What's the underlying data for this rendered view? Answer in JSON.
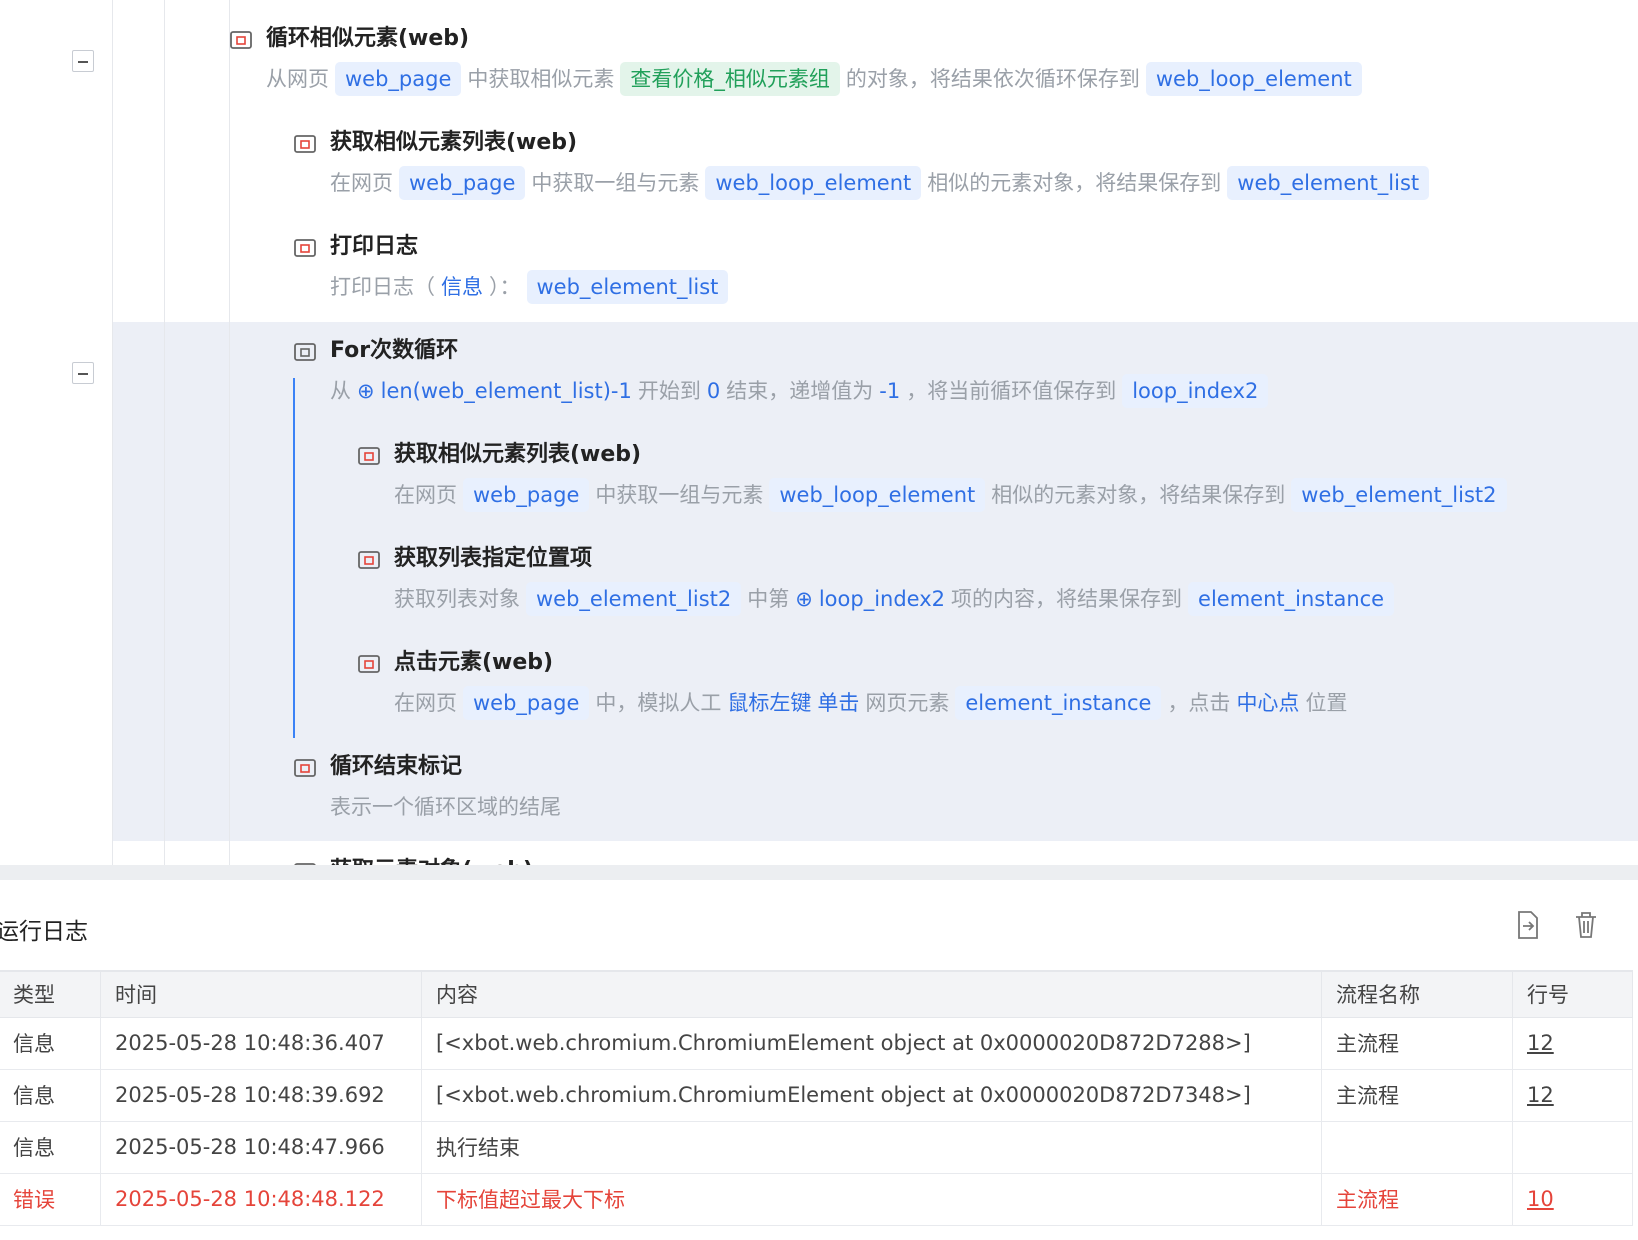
{
  "steps": [
    {
      "title": "循环相似元素(web)",
      "icon": "loop-similar-icon",
      "desc": [
        {
          "t": "从网页",
          "k": "plain"
        },
        {
          "t": "web_page",
          "k": "var"
        },
        {
          "t": "中获取相似元素",
          "k": "plain"
        },
        {
          "t": "查看价格_相似元素组",
          "k": "grn"
        },
        {
          "t": "的对象，将结果依次循环保存到",
          "k": "plain"
        },
        {
          "t": "web_loop_element",
          "k": "var"
        }
      ]
    },
    {
      "title": "获取相似元素列表(web)",
      "icon": "similar-list-icon",
      "desc": [
        {
          "t": "在网页",
          "k": "plain"
        },
        {
          "t": "web_page",
          "k": "var"
        },
        {
          "t": "中获取一组与元素",
          "k": "plain"
        },
        {
          "t": "web_loop_element",
          "k": "var"
        },
        {
          "t": "相似的元素对象，将结果保存到",
          "k": "plain"
        },
        {
          "t": "web_element_list",
          "k": "var"
        }
      ]
    },
    {
      "title": "打印日志",
      "icon": "print-icon",
      "desc": [
        {
          "t": "打印日志（",
          "k": "plain"
        },
        {
          "t": "信息",
          "k": "kw"
        },
        {
          "t": "）：",
          "k": "plain"
        },
        {
          "t": "web_element_list",
          "k": "var"
        }
      ]
    },
    {
      "title": "For次数循环",
      "icon": "for-loop-icon",
      "desc": [
        {
          "t": "从",
          "k": "plain"
        },
        {
          "t": "⊕",
          "k": "kw"
        },
        {
          "t": "len(web_element_list)-1",
          "k": "kw"
        },
        {
          "t": "开始到",
          "k": "plain"
        },
        {
          "t": "0",
          "k": "kw"
        },
        {
          "t": "结束，递增值为",
          "k": "plain"
        },
        {
          "t": "-1",
          "k": "kw"
        },
        {
          "t": "，将当前循环值保存到",
          "k": "plain"
        },
        {
          "t": "loop_index2",
          "k": "var"
        }
      ]
    },
    {
      "title": "获取相似元素列表(web)",
      "icon": "similar-list-icon",
      "desc": [
        {
          "t": "在网页",
          "k": "plain"
        },
        {
          "t": "web_page",
          "k": "var"
        },
        {
          "t": "中获取一组与元素",
          "k": "plain"
        },
        {
          "t": "web_loop_element",
          "k": "var"
        },
        {
          "t": "相似的元素对象，将结果保存到",
          "k": "plain"
        },
        {
          "t": "web_element_list2",
          "k": "var"
        }
      ]
    },
    {
      "title": "获取列表指定位置项",
      "icon": "list-item-icon",
      "desc": [
        {
          "t": "获取列表对象",
          "k": "plain"
        },
        {
          "t": "web_element_list2",
          "k": "var"
        },
        {
          "t": "中第",
          "k": "plain"
        },
        {
          "t": "⊕",
          "k": "kw"
        },
        {
          "t": "loop_index2",
          "k": "kw"
        },
        {
          "t": "项的内容，将结果保存到",
          "k": "plain"
        },
        {
          "t": "element_instance",
          "k": "var"
        }
      ]
    },
    {
      "title": "点击元素(web)",
      "icon": "click-element-icon",
      "desc": [
        {
          "t": "在网页",
          "k": "plain"
        },
        {
          "t": "web_page",
          "k": "var"
        },
        {
          "t": "中，模拟人工",
          "k": "plain"
        },
        {
          "t": "鼠标左键",
          "k": "kw"
        },
        {
          "t": "单击",
          "k": "kw"
        },
        {
          "t": "网页元素",
          "k": "plain"
        },
        {
          "t": "element_instance",
          "k": "var"
        },
        {
          "t": "，点击",
          "k": "plain"
        },
        {
          "t": "中心点",
          "k": "kw"
        },
        {
          "t": "位置",
          "k": "plain"
        }
      ]
    },
    {
      "title": "循环结束标记",
      "icon": "loop-end-icon",
      "desc": [
        {
          "t": "表示一个循环区域的结尾",
          "k": "plain"
        }
      ]
    },
    {
      "title": "获取元素对象(web)",
      "icon": "element-icon",
      "desc": []
    }
  ],
  "log": {
    "title": "运行日志",
    "columns": [
      "类型",
      "时间",
      "内容",
      "流程名称",
      "行号"
    ],
    "rows": [
      {
        "type": "信息",
        "time": "2025-05-28 10:48:36.407",
        "content": "[<xbot.web.chromium.ChromiumElement object at 0x0000020D872D7288>]",
        "flow": "主流程",
        "line": "12",
        "error": false
      },
      {
        "type": "信息",
        "time": "2025-05-28 10:48:39.692",
        "content": "[<xbot.web.chromium.ChromiumElement object at 0x0000020D872D7348>]",
        "flow": "主流程",
        "line": "12",
        "error": false
      },
      {
        "type": "信息",
        "time": "2025-05-28 10:48:47.966",
        "content": "执行结束",
        "flow": "",
        "line": "",
        "error": false
      },
      {
        "type": "错误",
        "time": "2025-05-28 10:48:48.122",
        "content": " 下标值超过最大下标",
        "flow": "主流程",
        "line": "10",
        "error": true
      }
    ]
  }
}
